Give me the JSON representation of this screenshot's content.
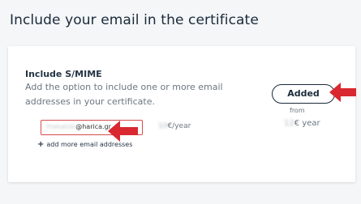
{
  "page": {
    "title": "Include your email in the certificate"
  },
  "option": {
    "title": "Include S/MIME",
    "description": "Add the option to include one or more email addresses in your certificate.",
    "button_label": "Added",
    "from_label": "from",
    "price_blurred": "12",
    "price_suffix": "€ year"
  },
  "email": {
    "local_blurred": "thekalids",
    "domain": "@harica.gr",
    "price_blurred": "10",
    "price_suffix": "€/year",
    "add_more_label": "add more email addresses"
  },
  "icons": {
    "add": "plus-icon",
    "annotation": "red-arrow-icon"
  },
  "colors": {
    "annotation_arrow": "#d9282f",
    "input_border": "#d84b4b",
    "text_dark": "#1b2a3a",
    "text_muted": "#6b7580"
  }
}
